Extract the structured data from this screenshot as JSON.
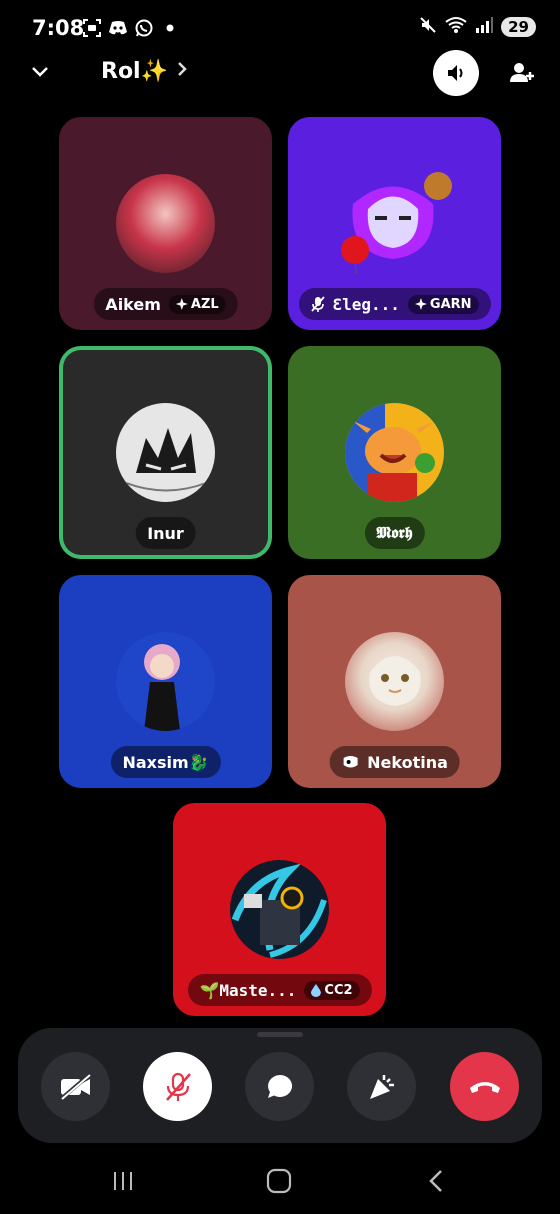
{
  "status_bar": {
    "time": "7:08",
    "left_icons": [
      "screenshot-icon",
      "discord-icon",
      "whatsapp-icon",
      "dot-icon"
    ],
    "right_icons": [
      "mute-icon",
      "wifi-icon",
      "signal-icon"
    ],
    "battery": "29"
  },
  "header": {
    "channel_name": "Rol✨"
  },
  "participants": [
    {
      "name": "Aikem",
      "tag": "AZL",
      "tag_icon": "sparkle-icon",
      "bg": "#4a1a2c",
      "muted": false,
      "speaking": false
    },
    {
      "name": "Ɛleg...",
      "tag": "GARN",
      "tag_icon": "sparkle-icon",
      "bg": "#5b1fe0",
      "muted": true,
      "speaking": false
    },
    {
      "name": "Inur",
      "tag": "",
      "bg": "#2a2a2a",
      "muted": false,
      "speaking": true
    },
    {
      "name": "𝕸𝖔𝖗𝖍",
      "tag": "",
      "bg": "#3a6e25",
      "muted": false,
      "speaking": false
    },
    {
      "name": "Naxsim🐉",
      "tag": "",
      "bg": "#1c3ec0",
      "muted": false,
      "speaking": false
    },
    {
      "name": "Nekotina",
      "tag": "",
      "bg": "#a85448",
      "muted": false,
      "speaking": false,
      "prefix_icon": "soundboard-icon"
    },
    {
      "name": "🌱Maste...",
      "tag": "CC2",
      "tag_icon": "drop-icon",
      "bg": "#d4101c",
      "muted": false,
      "speaking": false
    }
  ],
  "controls": [
    "camera-off",
    "mic-muted",
    "chat",
    "soundboard",
    "disconnect"
  ],
  "colors": {
    "speaking_ring": "#3fb96a",
    "disconnect": "#e3364b",
    "controls_bg": "#1e1f22"
  }
}
